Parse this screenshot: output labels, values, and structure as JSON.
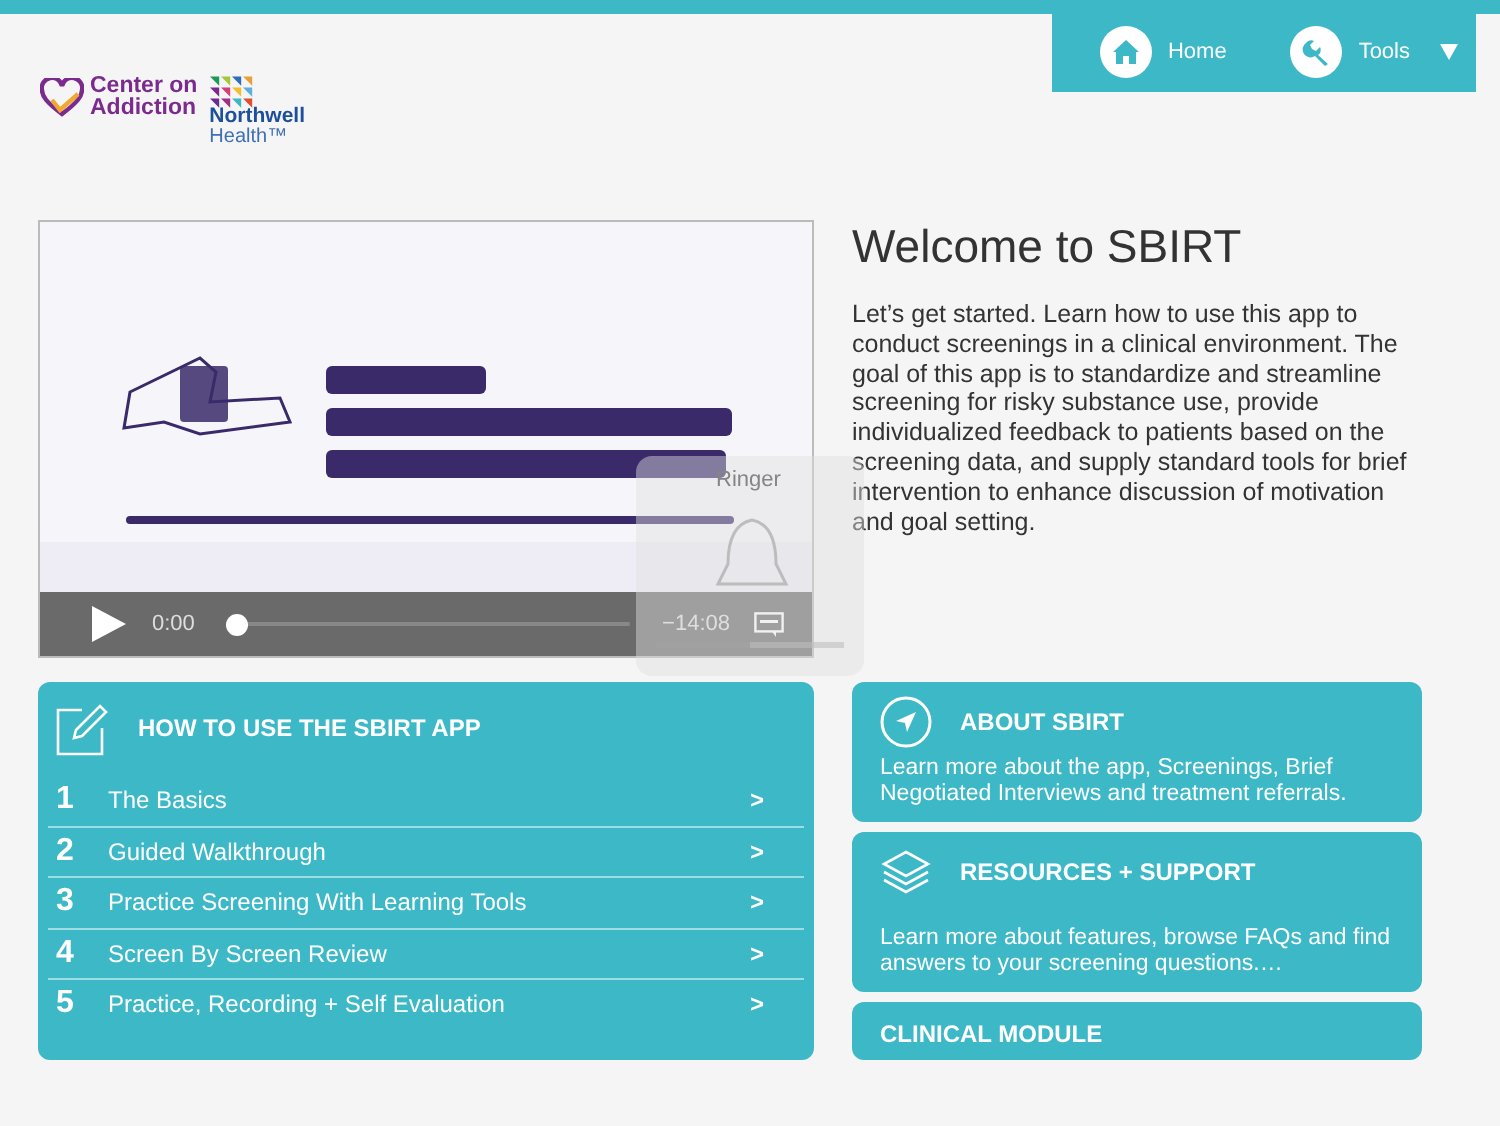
{
  "nav": [
    {
      "label": "Home",
      "dropdown": false
    },
    {
      "label": "Tools",
      "dropdown": true
    }
  ],
  "logos": [
    {
      "kind": "center",
      "lines": [
        "Center on",
        "Addiction"
      ]
    },
    {
      "kind": "northwell",
      "lines": [
        "Northwell",
        "Health™"
      ]
    }
  ],
  "video": {
    "kind": "picture",
    "elapsed": "0:00",
    "remaining": "−14:08",
    "level": 0
  },
  "ringer": {
    "title": "Ringer",
    "level": 0.5
  },
  "welcome": {
    "title": "Welcome to SBIRT",
    "text": "Let’s get started. Learn how to use this app to conduct screenings in a clinical environment. The goal of this app is to standardize and streamline screening for risky substance use, provide individualized feedback to patients based on the screening data, and supply standard tools for brief intervention to enhance discussion of motivation and goal setting."
  },
  "how_to": {
    "title": "HOW TO USE THE SBIRT APP",
    "items": [
      {
        "number": "1",
        "label": "The Basics",
        "chevron": ">"
      },
      {
        "number": "2",
        "label": "Guided Walkthrough",
        "chevron": ">"
      },
      {
        "number": "3",
        "label": "Practice Screening With Learning Tools",
        "chevron": ">"
      },
      {
        "number": "4",
        "label": "Screen By Screen Review",
        "chevron": ">"
      },
      {
        "number": "5",
        "label": "Practice, Recording + Self Evaluation",
        "chevron": ">"
      }
    ]
  },
  "cards": [
    {
      "kind": "info",
      "title": "ABOUT SBIRT",
      "text": "Learn more about the app, Screenings, Brief Negotiated Interviews and treatment referrals."
    },
    {
      "kind": "info",
      "title": "RESOURCES + SUPPORT",
      "text": "Learn more about features, browse FAQs and find answers to your screening questions.…"
    },
    {
      "kind": "link",
      "title": "CLINICAL MODULE"
    }
  ]
}
